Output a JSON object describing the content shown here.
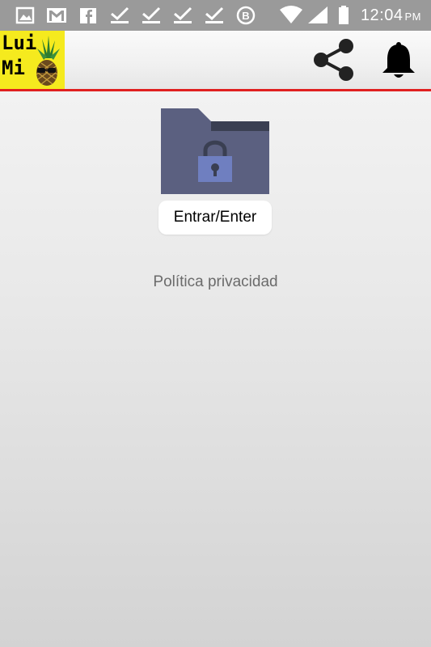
{
  "status_bar": {
    "time": "12:04",
    "ampm": "PM",
    "icons": [
      "image-icon",
      "gmail-icon",
      "facebook-icon",
      "check-download-icon",
      "check-download-icon",
      "check-download-icon",
      "check-download-icon",
      "b-circle-icon",
      "wifi-icon",
      "signal-icon",
      "battery-icon"
    ]
  },
  "app_bar": {
    "logo_line1": "Lui",
    "logo_line2": "Mi",
    "logo_bg_color": "#f5ea1e",
    "divider_color": "#e02020"
  },
  "main": {
    "folder_icon": "locked-folder-icon",
    "enter_label": "Entrar/Enter",
    "privacy_label": "Política privacidad"
  }
}
